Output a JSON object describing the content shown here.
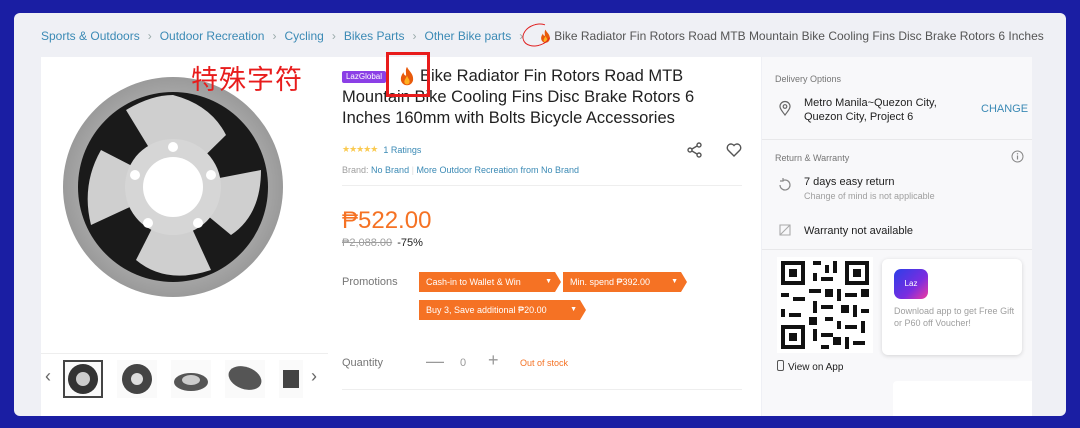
{
  "breadcrumb": {
    "items": [
      "Sports & Outdoors",
      "Outdoor Recreation",
      "Cycling",
      "Bikes Parts",
      "Other Bike parts"
    ],
    "current": "Bike Radiator Fin Rotors Road MTB Mountain Bike Cooling Fins Disc Brake Rotors 6 Inches"
  },
  "annotation": "特殊字符",
  "product": {
    "badge": "LazGlobal",
    "title": "Bike Radiator Fin Rotors Road MTB Mountain Bike Cooling Fins Disc Brake Rotors 6 Inches 160mm with Bolts Bicycle Accessories",
    "ratings": "1 Ratings",
    "rating_stars": 5,
    "brand_label": "Brand:",
    "brand": "No Brand",
    "brand_more": "More Outdoor Recreation from No Brand",
    "price": "₱522.00",
    "old_price": "₱2,088.00",
    "discount": "-75%",
    "promotions_label": "Promotions",
    "promotions": [
      "Cash-in to Wallet & Win",
      "Min. spend ₱392.00",
      "Buy 3, Save additional ₱20.00"
    ],
    "quantity_label": "Quantity",
    "quantity": "0",
    "stock_status": "Out of stock"
  },
  "side": {
    "delivery_header": "Delivery Options",
    "location_line1": "Metro Manila~Quezon City,",
    "location_line2": "Quezon City, Project 6",
    "change": "CHANGE",
    "warranty_header": "Return & Warranty",
    "return_title": "7 days easy return",
    "return_sub": "Change of mind is not applicable",
    "warranty": "Warranty not available",
    "view_app": "View on App",
    "app_logo": "Laz",
    "app_text": "Download app to get Free Gift or P60 off Voucher!"
  },
  "colors": {
    "accent": "#f57224",
    "link": "#3b8ab5",
    "annotation": "#e81c1c",
    "background": "#1a1ea3"
  }
}
